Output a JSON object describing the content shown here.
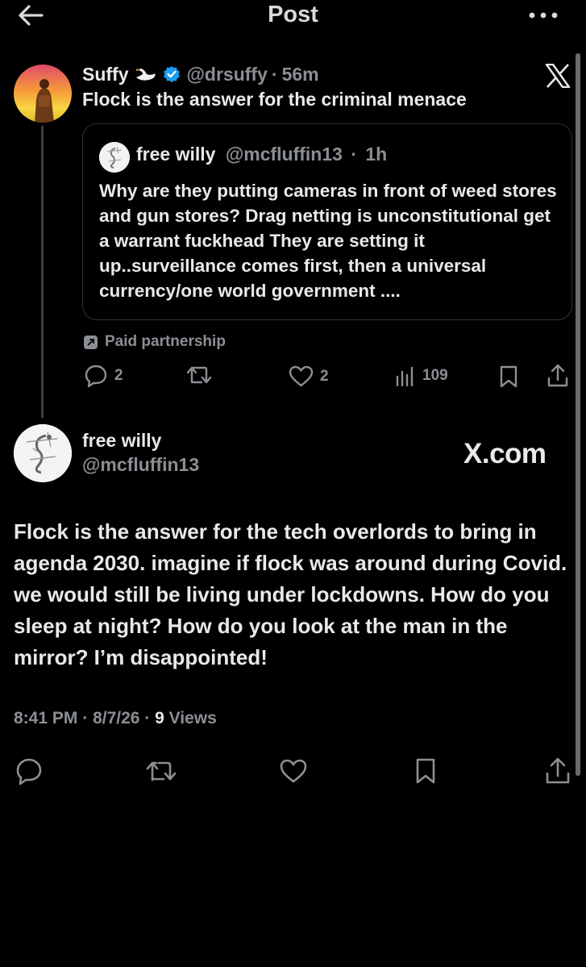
{
  "header": {
    "title": "Post",
    "back_icon": "arrow-left-icon",
    "more_icon": "more-horizontal-icon"
  },
  "quoted_post": {
    "author_name": "Suffy",
    "name_emoji": "swan-icon",
    "verified": true,
    "handle": "@drsuffy",
    "separator": "·",
    "time": "56m",
    "text": "Flock is the answer for the criminal menace",
    "platform_logo": "x-logo-icon",
    "inner_quote": {
      "author_name": "free willy",
      "handle": "@mcfluffin13",
      "separator": "·",
      "time": "1h",
      "text": "Why are they putting cameras in front of weed stores and gun stores? Drag netting is unconstitutional get a warrant fuckhead They are setting it up..surveillance comes first, then a universal currency/one world government ...."
    },
    "paid_label": "Paid partnership",
    "actions": {
      "replies": "2",
      "likes": "2",
      "views": "109"
    }
  },
  "reply_post": {
    "author_name": "free willy",
    "handle": "@mcfluffin13",
    "site_label": "X.com",
    "text": "Flock is the answer for the tech overlords to bring in agenda 2030. imagine if flock was around during Covid.  we would still be living under lockdowns. How do you sleep at night? How do you look at the man in the mirror? I’m disappointed!",
    "time": "8:41 PM",
    "date": "8/7/26",
    "views_count": "9",
    "views_label": "Views",
    "separator": "·"
  },
  "colors": {
    "background": "#000000",
    "text": "#e7e9ea",
    "muted": "#8b8f94",
    "verified": "#1d9bf0",
    "border": "#2f3336"
  }
}
